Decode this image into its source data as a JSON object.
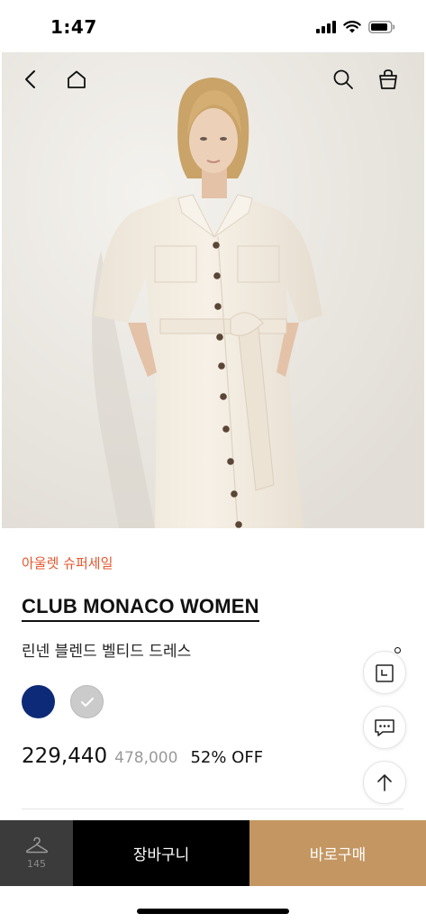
{
  "status_bar": {
    "time": "1:47",
    "icons": [
      "signal-icon",
      "wifi-icon",
      "battery-icon"
    ]
  },
  "header": {
    "icons": [
      "back-arrow-icon",
      "home-icon",
      "search-icon",
      "shopping-bag-icon"
    ]
  },
  "product": {
    "sale_label": "아울렛 슈퍼세일",
    "brand": "CLUB MONACO WOMEN",
    "name": "린넨 블렌드 벨티드 드레스",
    "swatches": [
      {
        "color": "#0d2a78",
        "selected": false
      },
      {
        "color": "#c8c8c8",
        "selected": true
      }
    ],
    "price_sale": "229,440",
    "price_original": "478,000",
    "discount": "52% OFF"
  },
  "floating_buttons": [
    "recent-view-icon",
    "chat-icon",
    "scroll-top-icon"
  ],
  "bottom_bar": {
    "wish_count": "145",
    "cart_label": "장바구니",
    "buy_label": "바로구매"
  },
  "colors": {
    "sale_accent": "#e4572e",
    "buy_button": "#c49661",
    "cart_button": "#000000",
    "wish_button": "#3b3b3b"
  }
}
